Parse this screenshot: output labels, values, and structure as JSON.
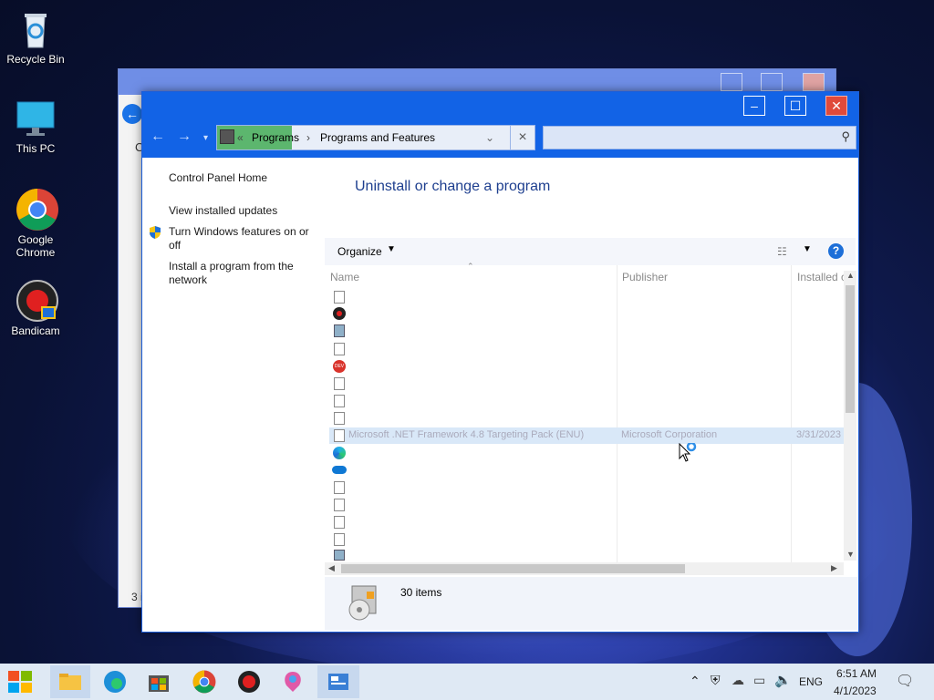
{
  "desktop": {
    "icons": [
      {
        "label": "Recycle Bin"
      },
      {
        "label": "This PC"
      },
      {
        "label": "Google Chrome"
      },
      {
        "label": "Bandicam"
      }
    ]
  },
  "window": {
    "breadcrumb": {
      "sep": "«",
      "part1": "Programs",
      "arrow": "›",
      "part2": "Programs and Features"
    },
    "search_placeholder": "",
    "left_panel": {
      "home": "Control Panel Home",
      "updates": "View installed updates",
      "features": "Turn Windows features on or off",
      "network": "Install a program from the network"
    },
    "heading": "Uninstall or change a program",
    "toolbar": {
      "organize": "Organize"
    },
    "columns": {
      "name": "Name",
      "publisher": "Publisher",
      "installed": "Installed o"
    },
    "selected_row": {
      "name": "Microsoft .NET Framework 4.8 Targeting Pack (ENU)",
      "publisher": "Microsoft Corporation",
      "installed": "3/31/2023"
    },
    "status": {
      "count": "30 items"
    }
  },
  "back_window": {
    "text1": "C",
    "text2": "3 i"
  },
  "taskbar": {
    "language": "ENG",
    "time": "6:51 AM",
    "date": "4/1/2023"
  },
  "colors": {
    "accent": "#1263e6",
    "heading": "#1e3f8f",
    "selection": "#d9e8f8"
  }
}
